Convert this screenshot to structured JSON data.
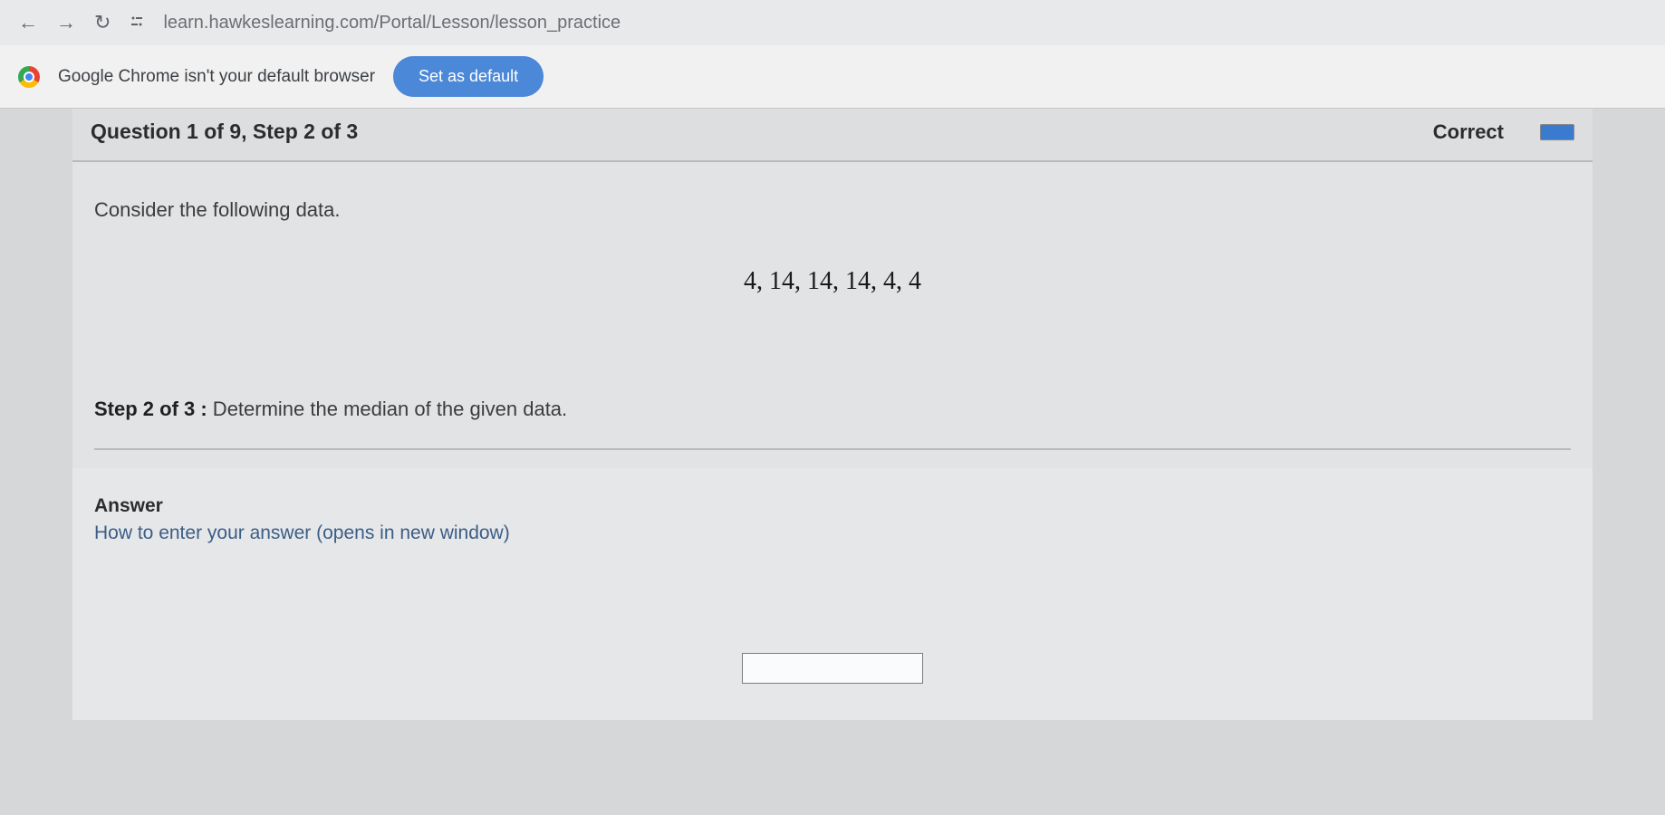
{
  "browser": {
    "url": "learn.hawkeslearning.com/Portal/Lesson/lesson_practice"
  },
  "infobar": {
    "message": "Google Chrome isn't your default browser",
    "button_label": "Set as default"
  },
  "header": {
    "question_title": "Question 1 of 9,  Step 2 of 3",
    "status": "Correct"
  },
  "question": {
    "prompt": "Consider the following data.",
    "data_values": "4, 14, 14, 14, 4, 4",
    "step_label": "Step 2 of 3 :",
    "step_text": "  Determine the median of the given data."
  },
  "answer": {
    "title": "Answer",
    "help_link": "How to enter your answer (opens in new window)",
    "input_value": ""
  }
}
